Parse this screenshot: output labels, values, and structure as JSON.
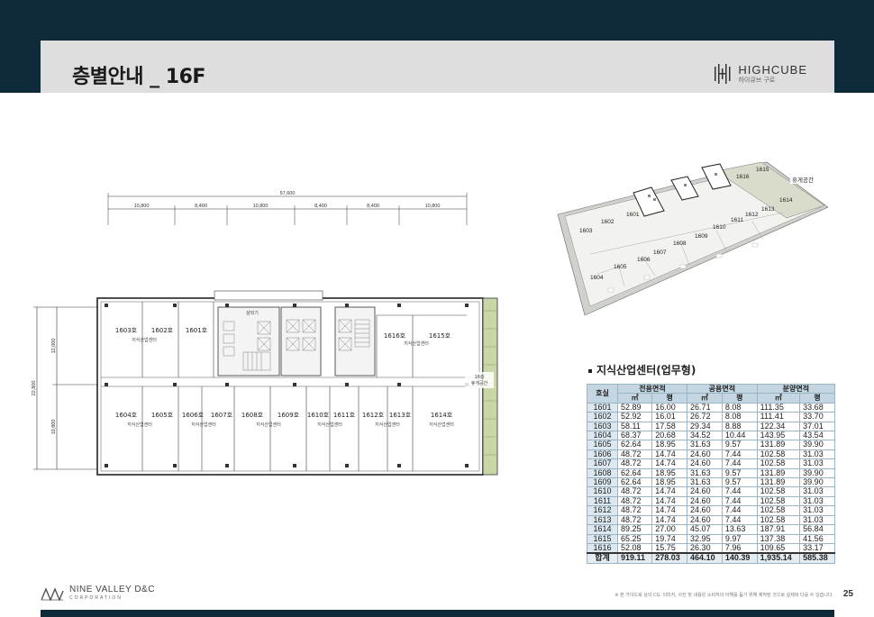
{
  "header": {
    "title": "층별안내 _ 16F",
    "logo_main": "HIGHCUBE",
    "logo_sub": "하이큐브 구로"
  },
  "floor_plan": {
    "overall_width": "57,600",
    "bay_dims": [
      "10,800",
      "8,400",
      "10,800",
      "8,400",
      "8,400",
      "10,800"
    ],
    "overall_height": "22,800",
    "vertical_dims": [
      "12,000",
      "10,800"
    ],
    "stair_label": "샬외기",
    "use_label": "지식산업센터",
    "top_rooms": [
      {
        "name": "1603호"
      },
      {
        "name": "1602호"
      },
      {
        "name": "1601호"
      },
      {
        "name": "1616호"
      },
      {
        "name": "1615호"
      }
    ],
    "bottom_rooms": [
      {
        "name": "1604호"
      },
      {
        "name": "1605호"
      },
      {
        "name": "1606호"
      },
      {
        "name": "1607호"
      },
      {
        "name": "1608호"
      },
      {
        "name": "1609호"
      },
      {
        "name": "1610호"
      },
      {
        "name": "1611호"
      },
      {
        "name": "1612호"
      },
      {
        "name": "1613호"
      },
      {
        "name": "1614호"
      }
    ],
    "terrace_label_1": "16층",
    "terrace_label_2": "휴게공간"
  },
  "iso_view": {
    "units": [
      "1601",
      "1602",
      "1603",
      "1604",
      "1605",
      "1606",
      "1607",
      "1608",
      "1609",
      "1610",
      "1611",
      "1612",
      "1613",
      "1614",
      "1615",
      "1616"
    ],
    "terrace_label": "휴게공간"
  },
  "area_table": {
    "section_title": "지식산업센터(업무형)",
    "headers": {
      "room": "호실",
      "exclusive": "전용면적",
      "common": "공용면적",
      "sale": "분양면적",
      "sqm": "㎡",
      "pyeong": "평"
    },
    "rows": [
      [
        "1601",
        "52.89",
        "16.00",
        "26.71",
        "8.08",
        "111.35",
        "33.68"
      ],
      [
        "1602",
        "52.92",
        "16.01",
        "26.72",
        "8.08",
        "111.41",
        "33.70"
      ],
      [
        "1603",
        "58.11",
        "17.58",
        "29.34",
        "8.88",
        "122.34",
        "37.01"
      ],
      [
        "1604",
        "68.37",
        "20.68",
        "34.52",
        "10.44",
        "143.95",
        "43.54"
      ],
      [
        "1605",
        "62.64",
        "18.95",
        "31.63",
        "9.57",
        "131.89",
        "39.90"
      ],
      [
        "1606",
        "48.72",
        "14.74",
        "24.60",
        "7.44",
        "102.58",
        "31.03"
      ],
      [
        "1607",
        "48.72",
        "14.74",
        "24.60",
        "7.44",
        "102.58",
        "31.03"
      ],
      [
        "1608",
        "62.64",
        "18.95",
        "31.63",
        "9.57",
        "131.89",
        "39.90"
      ],
      [
        "1609",
        "62.64",
        "18.95",
        "31.63",
        "9.57",
        "131.89",
        "39.90"
      ],
      [
        "1610",
        "48.72",
        "14.74",
        "24.60",
        "7.44",
        "102.58",
        "31.03"
      ],
      [
        "1611",
        "48.72",
        "14.74",
        "24.60",
        "7.44",
        "102.58",
        "31.03"
      ],
      [
        "1612",
        "48.72",
        "14.74",
        "24.60",
        "7.44",
        "102.58",
        "31.03"
      ],
      [
        "1613",
        "48.72",
        "14.74",
        "24.60",
        "7.44",
        "102.58",
        "31.03"
      ],
      [
        "1614",
        "89.25",
        "27.00",
        "45.07",
        "13.63",
        "187.91",
        "56.84"
      ],
      [
        "1615",
        "65.25",
        "19.74",
        "32.95",
        "9.97",
        "137.38",
        "41.56"
      ],
      [
        "1616",
        "52.08",
        "15.75",
        "26.30",
        "7.96",
        "109.65",
        "33.17"
      ]
    ],
    "total": [
      "합계",
      "919.11",
      "278.03",
      "464.10",
      "140.39",
      "1,935.14",
      "585.38"
    ]
  },
  "footer": {
    "company": "NINE VALLEY D&C",
    "company_sub": "CORPORATION",
    "disclaimer": "※ 본 가이드북 상의 CG, 이미지, 사진 및 내용은 소비자의 이해를 돕기 위해 제작된 것으로 실제와 다를 수 있습니다.",
    "page_number": "25"
  },
  "colors": {
    "band": "#0f2b3a",
    "header_bar": "#dedede",
    "table_header": "#c4d6e2",
    "table_room": "#dbe8f0"
  }
}
